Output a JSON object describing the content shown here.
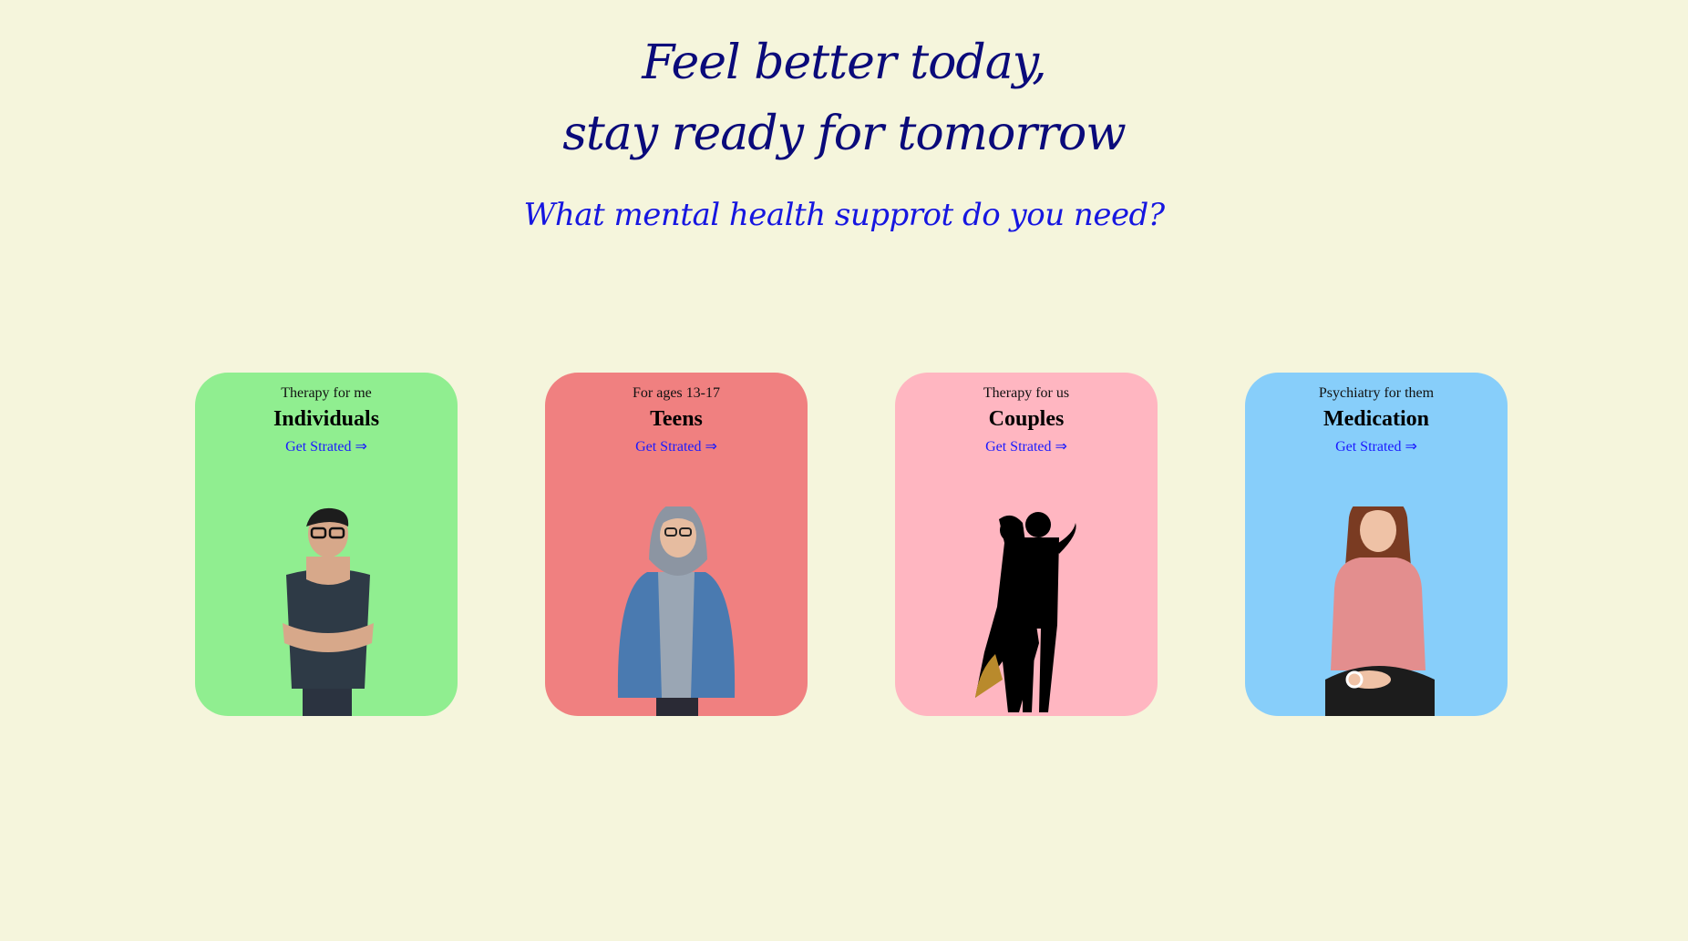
{
  "hero": {
    "title_line1": "Feel better today,",
    "title_line2": "stay ready for tomorrow",
    "subtitle": "What mental health supprot do you need?"
  },
  "colors": {
    "background": "#f5f5dc",
    "title": "#0a0a7a",
    "subtitle": "#1616e0",
    "link": "#1a1aff"
  },
  "cards": [
    {
      "eyebrow": "Therapy for me",
      "name": "Individuals",
      "cta": "Get Strated ⇒",
      "color": "#90ee90",
      "image": "man-crossed-arms-photo"
    },
    {
      "eyebrow": "For ages 13-17",
      "name": "Teens",
      "cta": "Get Strated ⇒",
      "color": "#f08080",
      "image": "teen-in-denim-jacket-photo"
    },
    {
      "eyebrow": "Therapy for us",
      "name": "Couples",
      "cta": "Get Strated ⇒",
      "color": "#ffb6c1",
      "image": "couple-silhouette-photo"
    },
    {
      "eyebrow": "Psychiatry for them",
      "name": "Medication",
      "cta": "Get Strated ⇒",
      "color": "#87cefa",
      "image": "woman-seated-photo"
    }
  ]
}
